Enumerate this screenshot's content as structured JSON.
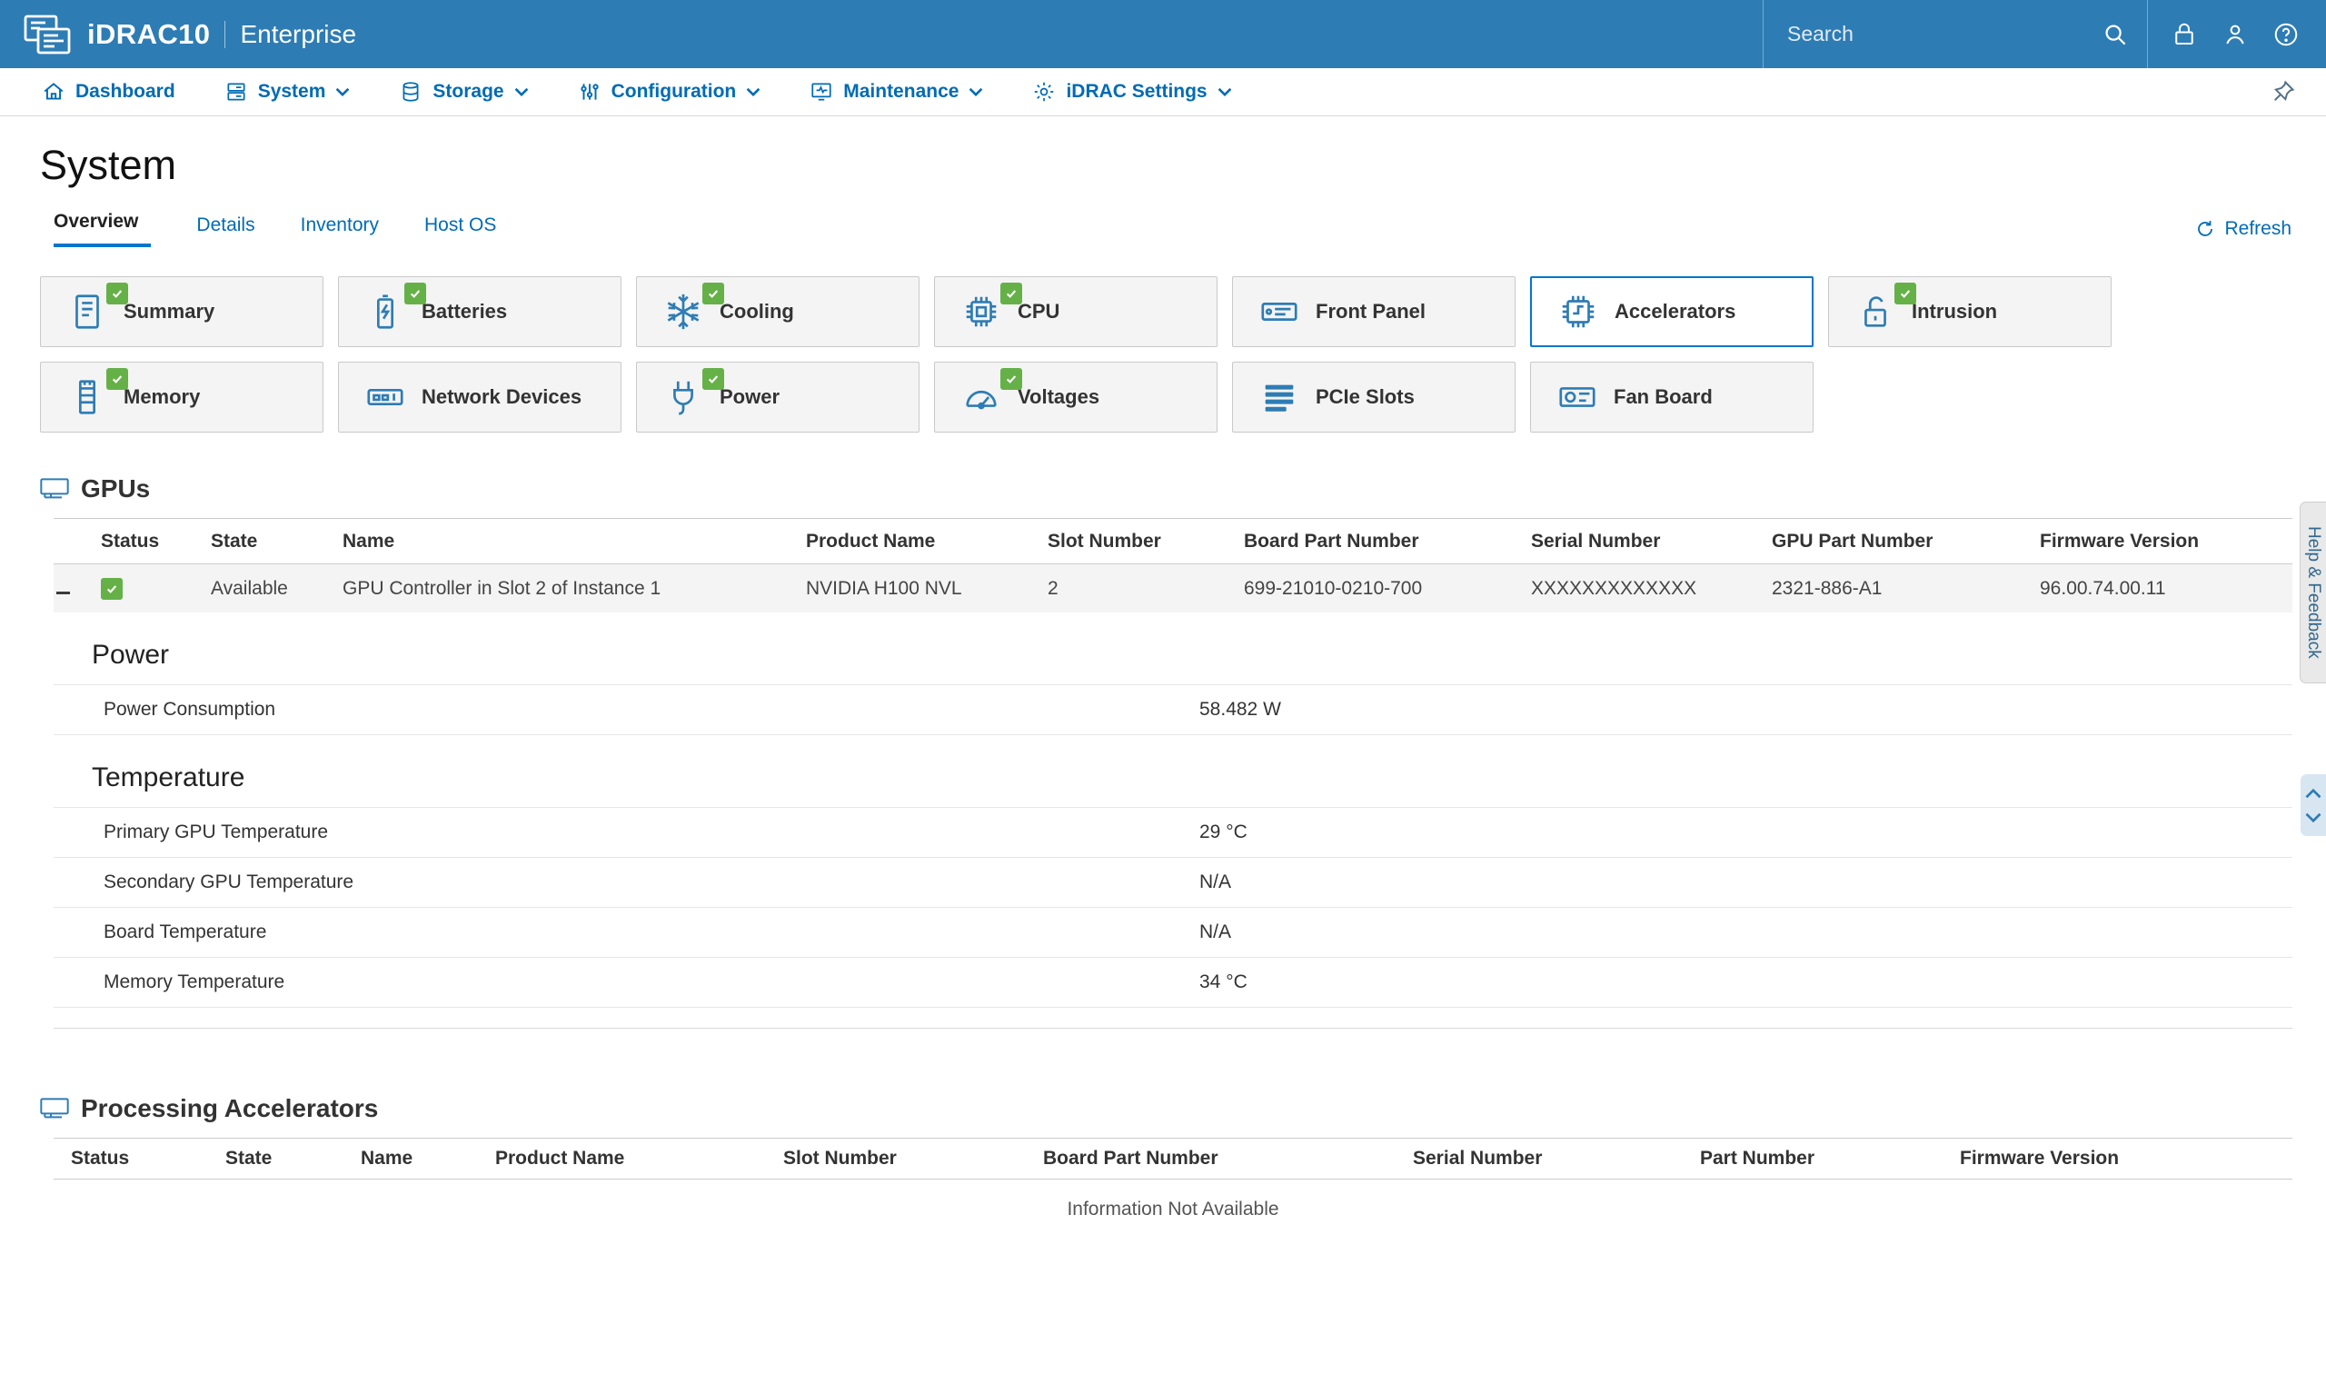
{
  "header": {
    "brand": "iDRAC10",
    "edition": "Enterprise",
    "search_placeholder": "Search"
  },
  "nav": {
    "items": [
      {
        "label": "Dashboard"
      },
      {
        "label": "System"
      },
      {
        "label": "Storage"
      },
      {
        "label": "Configuration"
      },
      {
        "label": "Maintenance"
      },
      {
        "label": "iDRAC Settings"
      }
    ]
  },
  "page": {
    "title": "System",
    "tabs": [
      {
        "label": "Overview",
        "active": true
      },
      {
        "label": "Details",
        "active": false
      },
      {
        "label": "Inventory",
        "active": false
      },
      {
        "label": "Host OS",
        "active": false
      }
    ],
    "refresh_label": "Refresh"
  },
  "tiles": {
    "items": [
      {
        "label": "Summary",
        "healthy": true,
        "selected": false
      },
      {
        "label": "Batteries",
        "healthy": true,
        "selected": false
      },
      {
        "label": "Cooling",
        "healthy": true,
        "selected": false
      },
      {
        "label": "CPU",
        "healthy": true,
        "selected": false
      },
      {
        "label": "Front Panel",
        "healthy": false,
        "selected": false
      },
      {
        "label": "Accelerators",
        "healthy": false,
        "selected": true
      },
      {
        "label": "Intrusion",
        "healthy": true,
        "selected": false
      },
      {
        "label": "Memory",
        "healthy": true,
        "selected": false
      },
      {
        "label": "Network Devices",
        "healthy": false,
        "selected": false
      },
      {
        "label": "Power",
        "healthy": true,
        "selected": false
      },
      {
        "label": "Voltages",
        "healthy": true,
        "selected": false
      },
      {
        "label": "PCIe Slots",
        "healthy": false,
        "selected": false
      },
      {
        "label": "Fan Board",
        "healthy": false,
        "selected": false
      }
    ]
  },
  "gpus": {
    "title": "GPUs",
    "columns": [
      "Status",
      "State",
      "Name",
      "Product Name",
      "Slot Number",
      "Board Part Number",
      "Serial Number",
      "GPU Part Number",
      "Firmware Version"
    ],
    "row": {
      "state": "Available",
      "name": "GPU Controller in Slot 2 of Instance 1",
      "product_name": "NVIDIA H100 NVL",
      "slot_number": "2",
      "board_part_number": "699-21010-0210-700",
      "serial_number": "XXXXXXXXXXXXX",
      "gpu_part_number": "2321-886-A1",
      "firmware_version": "96.00.74.00.11"
    },
    "power": {
      "title": "Power",
      "rows": [
        {
          "label": "Power Consumption",
          "value": "58.482 W"
        }
      ]
    },
    "temperature": {
      "title": "Temperature",
      "rows": [
        {
          "label": "Primary GPU Temperature",
          "value": "29 °C"
        },
        {
          "label": "Secondary GPU Temperature",
          "value": "N/A"
        },
        {
          "label": "Board Temperature",
          "value": "N/A"
        },
        {
          "label": "Memory Temperature",
          "value": "34 °C"
        }
      ]
    }
  },
  "processing_accelerators": {
    "title": "Processing Accelerators",
    "columns": [
      "Status",
      "State",
      "Name",
      "Product Name",
      "Slot Number",
      "Board Part Number",
      "Serial Number",
      "Part Number",
      "Firmware Version"
    ],
    "empty_message": "Information Not Available"
  },
  "side": {
    "help_label": "Help & Feedback"
  },
  "colors": {
    "header_blue": "#2e7cb4",
    "link_blue": "#006bb4",
    "status_green": "#65b148",
    "selected_border": "#0076ce"
  }
}
